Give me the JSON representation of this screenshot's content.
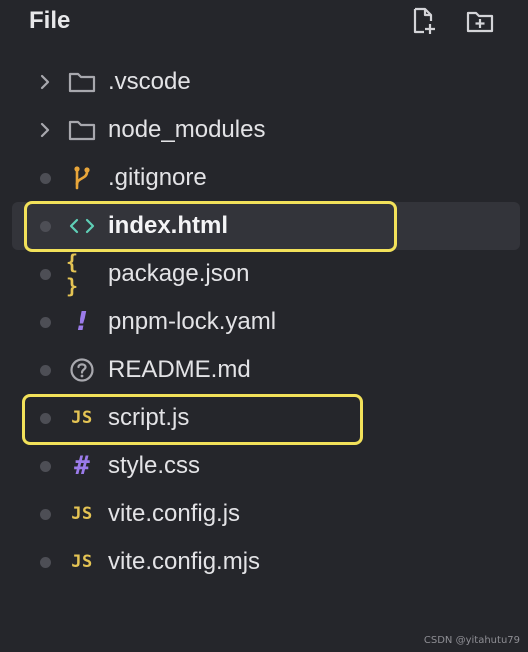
{
  "header": {
    "title": "File",
    "new_file_icon": "new-file-icon",
    "new_folder_icon": "new-folder-icon"
  },
  "files": [
    {
      "label": ".vscode",
      "kind": "folder",
      "icon": "folder-icon",
      "lead": "chevron-right-icon"
    },
    {
      "label": "node_modules",
      "kind": "folder",
      "icon": "folder-icon",
      "lead": "chevron-right-icon"
    },
    {
      "label": ".gitignore",
      "kind": "file",
      "icon": "git-branch-icon"
    },
    {
      "label": "index.html",
      "kind": "file",
      "icon": "html-code-icon",
      "active": true
    },
    {
      "label": "package.json",
      "kind": "file",
      "icon": "json-braces-icon",
      "icon_text": "{ }"
    },
    {
      "label": "pnpm-lock.yaml",
      "kind": "file",
      "icon": "yaml-exclamation-icon",
      "icon_text": "!"
    },
    {
      "label": "README.md",
      "kind": "file",
      "icon": "question-circle-icon"
    },
    {
      "label": "script.js",
      "kind": "file",
      "icon": "js-icon",
      "icon_text": "JS"
    },
    {
      "label": "style.css",
      "kind": "file",
      "icon": "css-hash-icon",
      "icon_text": "#"
    },
    {
      "label": "vite.config.js",
      "kind": "file",
      "icon": "js-icon",
      "icon_text": "JS"
    },
    {
      "label": "vite.config.mjs",
      "kind": "file",
      "icon": "js-icon",
      "icon_text": "JS"
    }
  ],
  "colors": {
    "background": "#25262b",
    "active_row": "#33343a",
    "highlight": "#f2e15a",
    "js": "#e5c454",
    "purple": "#9b7bea",
    "html": "#5fcfb6",
    "git": "#e9a63a"
  },
  "watermark": "CSDN @yitahutu79"
}
